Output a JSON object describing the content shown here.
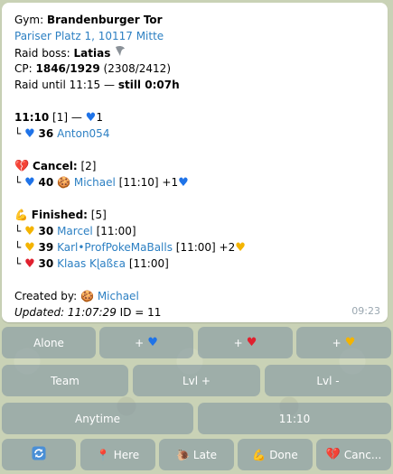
{
  "message": {
    "gym_label": "Gym:",
    "gym_name": "Brandenburger Tor",
    "address": "Pariser Platz 1, 10117 Mitte",
    "boss_label": "Raid boss:",
    "boss_name": "Latias",
    "cp_label": "CP:",
    "cp_value": "1846/1929",
    "cp_boosted": "(2308/2412)",
    "raid_until_text": "Raid until 11:15 —",
    "raid_still": "still 0:07h",
    "slot_time": "11:10",
    "slot_count": "[1] —",
    "slot_blue_count": "1",
    "slot_entry_prefix": "└",
    "slot_entry_level": "36",
    "slot_entry_user": "Anton054",
    "cancel_label": "Cancel:",
    "cancel_count": "[2]",
    "cancel_entry_prefix": "└",
    "cancel_entry_level": "40",
    "cancel_entry_user": "Michael",
    "cancel_entry_time": "[11:10] +1",
    "finished_label": "Finished:",
    "finished_count": "[5]",
    "finished": [
      {
        "prefix": "└",
        "level": "30",
        "user": "Marcel",
        "time": "[11:00]",
        "extra": ""
      },
      {
        "prefix": "└",
        "level": "39",
        "user": "Karl•ProfPokeMaBalls",
        "time": "[11:00] +2",
        "extra": "heart"
      },
      {
        "prefix": "└",
        "level": "30",
        "user": "Klaas Kɭaßɛa",
        "time": "[11:00]",
        "extra": ""
      }
    ],
    "created_label": "Created by:",
    "created_user": "Michael",
    "updated_label": "Updated: 11:07:29",
    "id_text": "ID = 11",
    "timestamp": "09:23"
  },
  "keyboard": {
    "row1": [
      "Alone",
      "+",
      "+",
      "+"
    ],
    "row2": [
      "Team",
      "Lvl +",
      "Lvl -"
    ],
    "row3": [
      "Anytime",
      "11:10"
    ],
    "row4": [
      "",
      "Here",
      "Late",
      "Done",
      "Canc..."
    ]
  },
  "colors": {
    "link": "#2d80c3",
    "blue_heart": "#1f73e8",
    "red_heart": "#e0202e",
    "yellow_heart": "#f4b400",
    "button_bg": "#8094a0"
  },
  "icons": [
    "wing-icon",
    "blue-heart-icon",
    "broken-heart-icon",
    "cookie-icon",
    "biceps-icon",
    "yellow-heart-icon",
    "red-heart-icon",
    "refresh-icon",
    "pin-icon",
    "snail-icon"
  ]
}
